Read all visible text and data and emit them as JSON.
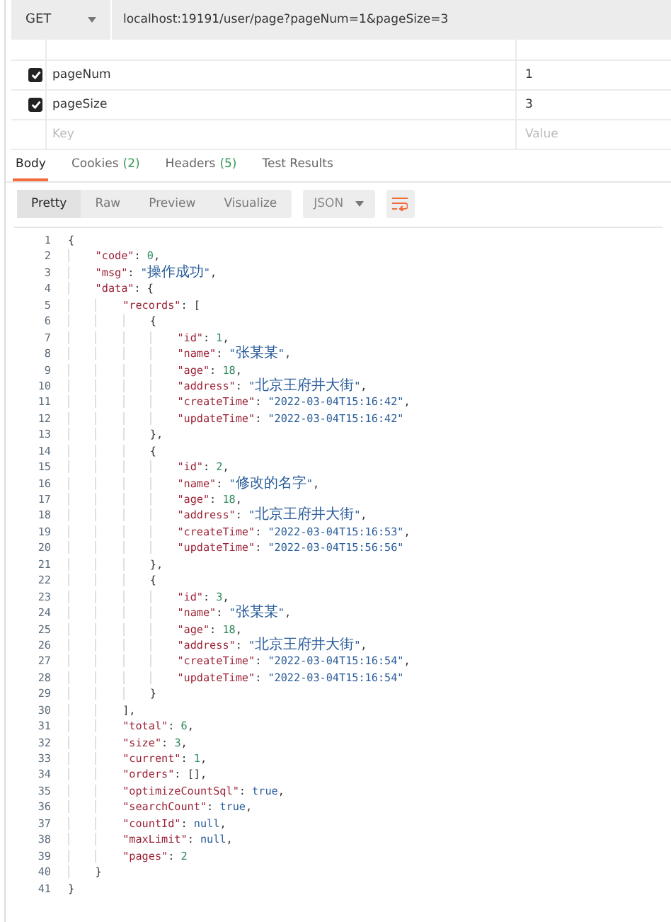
{
  "request": {
    "method": "GET",
    "url": "localhost:19191/user/page?pageNum=1&pageSize=3"
  },
  "params": [
    {
      "key": "pageNum",
      "value": "1",
      "checked": true
    },
    {
      "key": "pageSize",
      "value": "3",
      "checked": true
    }
  ],
  "new_param": {
    "key_placeholder": "Key",
    "value_placeholder": "Value"
  },
  "tabs": [
    {
      "label": "Body",
      "selected": true
    },
    {
      "label": "Cookies",
      "count": "(2)",
      "selected": false
    },
    {
      "label": "Headers",
      "count": "(5)",
      "selected": false
    },
    {
      "label": "Test Results",
      "selected": false
    }
  ],
  "view_modes": [
    {
      "label": "Pretty",
      "selected": true
    },
    {
      "label": "Raw",
      "selected": false
    },
    {
      "label": "Preview",
      "selected": false
    },
    {
      "label": "Visualize",
      "selected": false
    }
  ],
  "format": "JSON",
  "code_lines": [
    {
      "number": "1",
      "text": "{"
    },
    {
      "number": "2",
      "text": "    \"code\": 0,"
    },
    {
      "number": "3",
      "text": "    \"msg\": \"操作成功\","
    },
    {
      "number": "4",
      "text": "    \"data\": {"
    },
    {
      "number": "5",
      "text": "        \"records\": ["
    },
    {
      "number": "6",
      "text": "            {"
    },
    {
      "number": "7",
      "text": "                \"id\": 1,"
    },
    {
      "number": "8",
      "text": "                \"name\": \"张某某\","
    },
    {
      "number": "9",
      "text": "                \"age\": 18,"
    },
    {
      "number": "10",
      "text": "                \"address\": \"北京王府井大街\","
    },
    {
      "number": "11",
      "text": "                \"createTime\": \"2022-03-04T15:16:42\","
    },
    {
      "number": "12",
      "text": "                \"updateTime\": \"2022-03-04T15:16:42\""
    },
    {
      "number": "13",
      "text": "            },"
    },
    {
      "number": "14",
      "text": "            {"
    },
    {
      "number": "15",
      "text": "                \"id\": 2,"
    },
    {
      "number": "16",
      "text": "                \"name\": \"修改的名字\","
    },
    {
      "number": "17",
      "text": "                \"age\": 18,"
    },
    {
      "number": "18",
      "text": "                \"address\": \"北京王府井大街\","
    },
    {
      "number": "19",
      "text": "                \"createTime\": \"2022-03-04T15:16:53\","
    },
    {
      "number": "20",
      "text": "                \"updateTime\": \"2022-03-04T15:56:56\""
    },
    {
      "number": "21",
      "text": "            },"
    },
    {
      "number": "22",
      "text": "            {"
    },
    {
      "number": "23",
      "text": "                \"id\": 3,"
    },
    {
      "number": "24",
      "text": "                \"name\": \"张某某\","
    },
    {
      "number": "25",
      "text": "                \"age\": 18,"
    },
    {
      "number": "26",
      "text": "                \"address\": \"北京王府井大街\","
    },
    {
      "number": "27",
      "text": "                \"createTime\": \"2022-03-04T15:16:54\","
    },
    {
      "number": "28",
      "text": "                \"updateTime\": \"2022-03-04T15:16:54\""
    },
    {
      "number": "29",
      "text": "            }"
    },
    {
      "number": "30",
      "text": "        ],"
    },
    {
      "number": "31",
      "text": "        \"total\": 6,"
    },
    {
      "number": "32",
      "text": "        \"size\": 3,"
    },
    {
      "number": "33",
      "text": "        \"current\": 1,"
    },
    {
      "number": "34",
      "text": "        \"orders\": [],"
    },
    {
      "number": "35",
      "text": "        \"optimizeCountSql\": true,"
    },
    {
      "number": "36",
      "text": "        \"searchCount\": true,"
    },
    {
      "number": "37",
      "text": "        \"countId\": null,"
    },
    {
      "number": "38",
      "text": "        \"maxLimit\": null,"
    },
    {
      "number": "39",
      "text": "        \"pages\": 2"
    },
    {
      "number": "40",
      "text": "    }"
    },
    {
      "number": "41",
      "text": "}"
    }
  ]
}
